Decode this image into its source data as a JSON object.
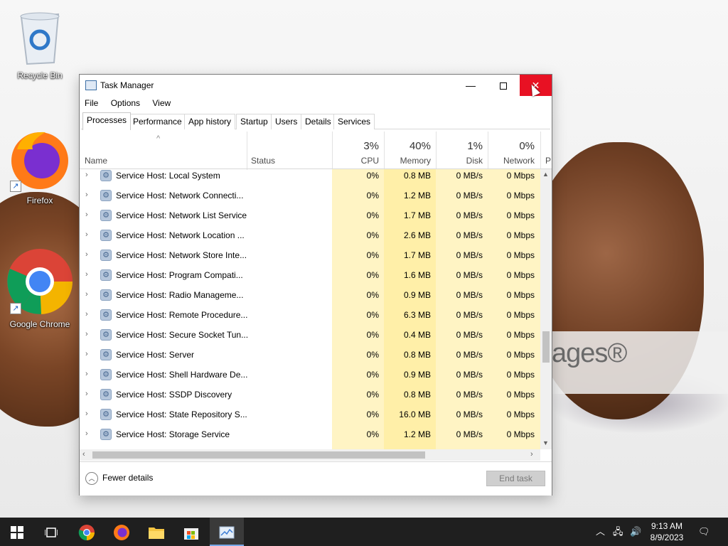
{
  "desktop": {
    "icons": [
      {
        "label": "Recycle Bin",
        "icon": "recycle-bin-icon"
      },
      {
        "label": "Firefox",
        "icon": "firefox-icon"
      },
      {
        "label": "Google Chrome",
        "icon": "chrome-icon"
      }
    ],
    "wallpaper_text": "ages®"
  },
  "window": {
    "title": "Task Manager",
    "controls": {
      "minimize": "—",
      "close": "✕"
    }
  },
  "menu": [
    "File",
    "Options",
    "View"
  ],
  "tabs": [
    {
      "label": "Processes",
      "active": true
    },
    {
      "label": "Performance",
      "active": false
    },
    {
      "label": "App history",
      "active": false
    },
    {
      "label": "Startup",
      "active": false
    },
    {
      "label": "Users",
      "active": false
    },
    {
      "label": "Details",
      "active": false
    },
    {
      "label": "Services",
      "active": false
    }
  ],
  "columns": {
    "name": "Name",
    "status": "Status",
    "cpu": {
      "label": "CPU",
      "pct": "3%"
    },
    "memory": {
      "label": "Memory",
      "pct": "40%"
    },
    "disk": {
      "label": "Disk",
      "pct": "1%"
    },
    "network": {
      "label": "Network",
      "pct": "0%"
    },
    "power_partial": "P"
  },
  "rows": [
    {
      "name": "Service Host: Local System",
      "cpu": "0%",
      "mem": "0.8 MB",
      "disk": "0 MB/s",
      "net": "0 Mbps"
    },
    {
      "name": "Service Host: Network Connecti...",
      "cpu": "0%",
      "mem": "1.2 MB",
      "disk": "0 MB/s",
      "net": "0 Mbps"
    },
    {
      "name": "Service Host: Network List Service",
      "cpu": "0%",
      "mem": "1.7 MB",
      "disk": "0 MB/s",
      "net": "0 Mbps"
    },
    {
      "name": "Service Host: Network Location ...",
      "cpu": "0%",
      "mem": "2.6 MB",
      "disk": "0 MB/s",
      "net": "0 Mbps"
    },
    {
      "name": "Service Host: Network Store Inte...",
      "cpu": "0%",
      "mem": "1.7 MB",
      "disk": "0 MB/s",
      "net": "0 Mbps"
    },
    {
      "name": "Service Host: Program Compati...",
      "cpu": "0%",
      "mem": "1.6 MB",
      "disk": "0 MB/s",
      "net": "0 Mbps"
    },
    {
      "name": "Service Host: Radio Manageme...",
      "cpu": "0%",
      "mem": "0.9 MB",
      "disk": "0 MB/s",
      "net": "0 Mbps"
    },
    {
      "name": "Service Host: Remote Procedure...",
      "cpu": "0%",
      "mem": "6.3 MB",
      "disk": "0 MB/s",
      "net": "0 Mbps"
    },
    {
      "name": "Service Host: Secure Socket Tun...",
      "cpu": "0%",
      "mem": "0.4 MB",
      "disk": "0 MB/s",
      "net": "0 Mbps"
    },
    {
      "name": "Service Host: Server",
      "cpu": "0%",
      "mem": "0.8 MB",
      "disk": "0 MB/s",
      "net": "0 Mbps"
    },
    {
      "name": "Service Host: Shell Hardware De...",
      "cpu": "0%",
      "mem": "0.9 MB",
      "disk": "0 MB/s",
      "net": "0 Mbps"
    },
    {
      "name": "Service Host: SSDP Discovery",
      "cpu": "0%",
      "mem": "0.8 MB",
      "disk": "0 MB/s",
      "net": "0 Mbps"
    },
    {
      "name": "Service Host: State Repository S...",
      "cpu": "0%",
      "mem": "16.0 MB",
      "disk": "0 MB/s",
      "net": "0 Mbps"
    },
    {
      "name": "Service Host: Storage Service",
      "cpu": "0%",
      "mem": "1.2 MB",
      "disk": "0 MB/s",
      "net": "0 Mbps"
    }
  ],
  "footer": {
    "fewer_details": "Fewer details",
    "end_task": "End task"
  },
  "taskbar": {
    "items": [
      "start-icon",
      "task-view-icon",
      "chrome-icon",
      "firefox-icon",
      "file-explorer-icon",
      "store-icon",
      "task-manager-icon"
    ],
    "time": "9:13 AM",
    "date": "8/9/2023"
  },
  "colors": {
    "close_red": "#e81123",
    "heat_light": "#fff4c4",
    "heat_memory": "#ffefa8",
    "taskbar": "#1f1f1f"
  }
}
